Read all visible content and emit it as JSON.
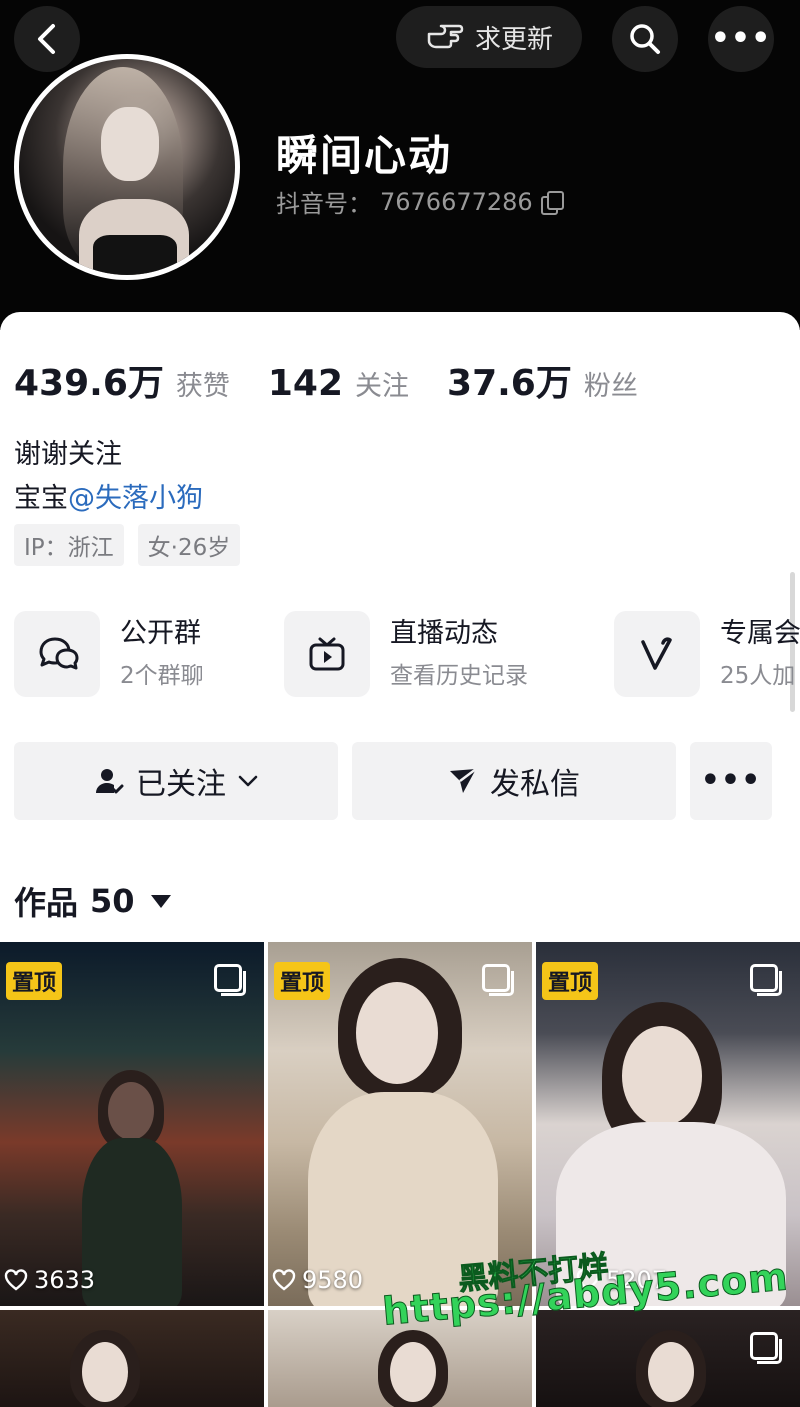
{
  "header": {
    "update_label": "求更新",
    "name": "瞬间心动",
    "douyin_id_label": "抖音号：",
    "douyin_id": "7676677286"
  },
  "stats": [
    {
      "value": "439.6万",
      "label": "获赞"
    },
    {
      "value": "142",
      "label": "关注"
    },
    {
      "value": "37.6万",
      "label": "粉丝"
    }
  ],
  "bio": {
    "line1": "谢谢关注",
    "line2_prefix": "宝宝",
    "mention": "@失落小狗"
  },
  "tags": [
    "IP：浙江",
    "女·26岁"
  ],
  "features": [
    {
      "title": "公开群",
      "subtitle": "2个群聊",
      "icon": "chat-bubbles-icon"
    },
    {
      "title": "直播动态",
      "subtitle": "查看历史记录",
      "icon": "tv-play-icon"
    },
    {
      "title": "专属会",
      "subtitle": "25人加",
      "icon": "v-check-icon"
    }
  ],
  "actions": {
    "followed": "已关注",
    "message": "发私信"
  },
  "works": {
    "label": "作品",
    "count": "50"
  },
  "grid": [
    {
      "pinned": "置顶",
      "likes": "3633"
    },
    {
      "pinned": "置顶",
      "likes": "9580"
    },
    {
      "pinned": "置顶",
      "likes": "5207"
    }
  ],
  "watermark": {
    "line1": "黑料不打烊",
    "line2": "https://abdy5.com"
  },
  "colors": {
    "header_bg": "#050505",
    "accent_badge": "#f5c518",
    "mention": "#2b6bbd",
    "watermark": "#33d35a"
  }
}
